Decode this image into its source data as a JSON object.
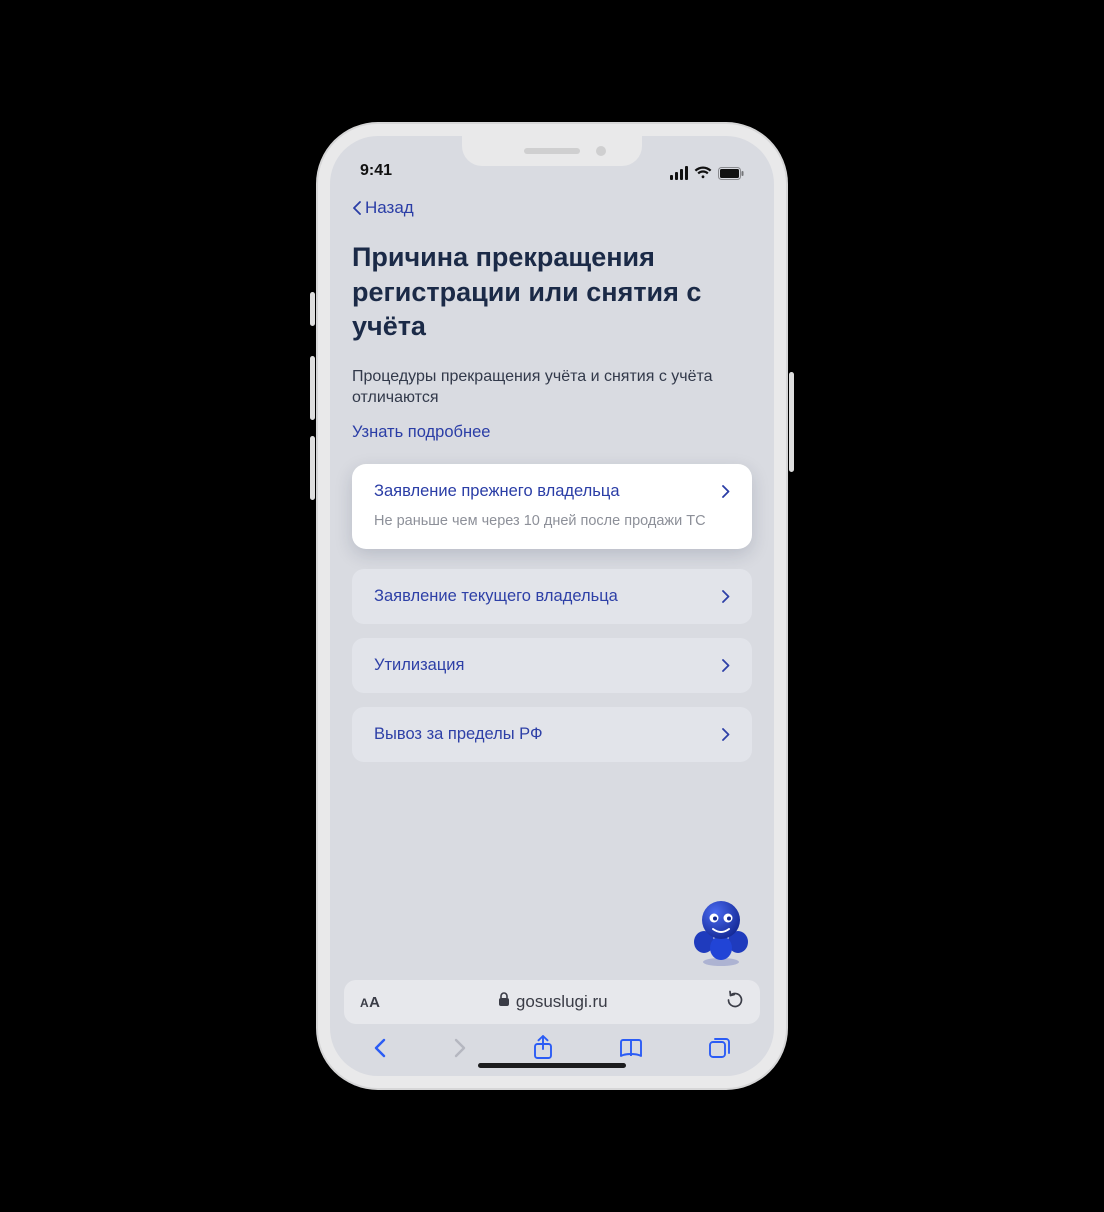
{
  "status": {
    "time": "9:41"
  },
  "nav": {
    "back_label": "Назад"
  },
  "page": {
    "title": "Причина прекращения регистрации или снятия с учёта",
    "subtitle": "Процедуры прекращения учёта и снятия с учёта отличаются",
    "learn_more": "Узнать подробнее"
  },
  "highlight": {
    "title": "Заявление прежнего владельца",
    "desc": "Не раньше чем через 10 дней после продажи ТС"
  },
  "options": [
    {
      "title": "Заявление текущего владельца"
    },
    {
      "title": "Утилизация"
    },
    {
      "title": "Вывоз за пределы РФ"
    }
  ],
  "urlbar": {
    "domain": "gosuslugi.ru"
  }
}
